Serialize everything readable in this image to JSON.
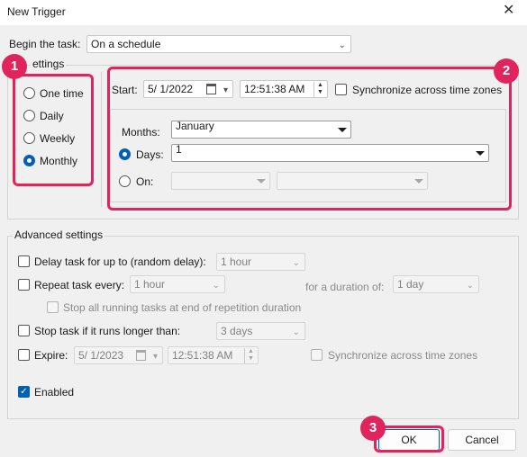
{
  "window": {
    "title": "New Trigger",
    "close_glyph": "✕"
  },
  "begin": {
    "label": "Begin the task:",
    "value": "On a schedule"
  },
  "settings": {
    "legend": "Settings",
    "legend_visible": "ettings",
    "radios": [
      {
        "label": "One time",
        "selected": false
      },
      {
        "label": "Daily",
        "selected": false
      },
      {
        "label": "Weekly",
        "selected": false
      },
      {
        "label": "Monthly",
        "selected": true
      }
    ],
    "start_label": "Start:",
    "start_date": "5/  1/2022",
    "start_time": "12:51:38 AM",
    "sync_label": "Synchronize across time zones",
    "months_label": "Months:",
    "months_value": "January",
    "days_label": "Days:",
    "days_value": "1",
    "on_label": "On:"
  },
  "advanced": {
    "legend": "Advanced settings",
    "delay_label": "Delay task for up to (random delay):",
    "delay_value": "1 hour",
    "repeat_label": "Repeat task every:",
    "repeat_value": "1 hour",
    "duration_label": "for a duration of:",
    "duration_value": "1 day",
    "stop_running_label": "Stop all running tasks at end of repetition duration",
    "stop_longer_label": "Stop task if it runs longer than:",
    "stop_longer_value": "3 days",
    "expire_label": "Expire:",
    "expire_date": "5/  1/2023",
    "expire_time": "12:51:38 AM",
    "expire_sync_label": "Synchronize across time zones",
    "enabled_label": "Enabled"
  },
  "buttons": {
    "ok": "OK",
    "cancel": "Cancel"
  },
  "badges": [
    "1",
    "2",
    "3"
  ],
  "colors": {
    "accent": "#005fb8",
    "highlight": "#e0245e"
  }
}
